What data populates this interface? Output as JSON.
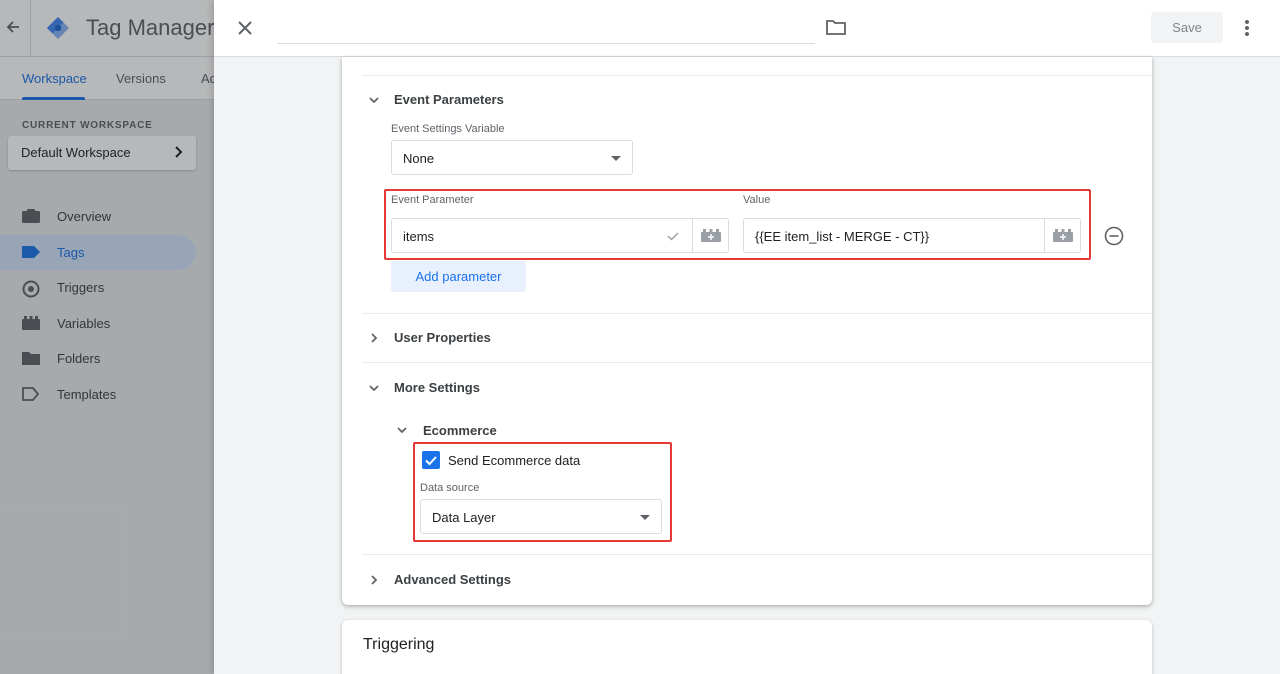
{
  "app": {
    "title": "Tag Manager",
    "tabs": [
      {
        "label": "Workspace",
        "active": true
      },
      {
        "label": "Versions"
      },
      {
        "label": "Ad"
      }
    ],
    "current_workspace_label": "CURRENT WORKSPACE",
    "workspace_name": "Default Workspace",
    "nav": [
      {
        "label": "Overview",
        "icon": "briefcase-icon"
      },
      {
        "label": "Tags",
        "icon": "tag-icon",
        "active": true
      },
      {
        "label": "Triggers",
        "icon": "trigger-icon"
      },
      {
        "label": "Variables",
        "icon": "variables-icon"
      },
      {
        "label": "Folders",
        "icon": "folder-icon"
      },
      {
        "label": "Templates",
        "icon": "template-icon"
      }
    ]
  },
  "panel": {
    "tag_name_value": "",
    "save_label": "Save"
  },
  "event_parameters": {
    "title": "Event Parameters",
    "settings_variable_label": "Event Settings Variable",
    "settings_variable_value": "None",
    "param_label": "Event Parameter",
    "value_label": "Value",
    "rows": [
      {
        "parameter": "items",
        "value": "{{EE item_list - MERGE - CT}}"
      }
    ],
    "add_label": "Add parameter"
  },
  "user_properties": {
    "title": "User Properties"
  },
  "more_settings": {
    "title": "More Settings",
    "ecommerce": {
      "title": "Ecommerce",
      "send_label": "Send Ecommerce data",
      "send_checked": true,
      "data_source_label": "Data source",
      "data_source_value": "Data Layer"
    }
  },
  "advanced_settings": {
    "title": "Advanced Settings"
  },
  "triggering": {
    "title": "Triggering"
  },
  "colors": {
    "accent": "#1a73e8",
    "highlight": "#e53935"
  }
}
